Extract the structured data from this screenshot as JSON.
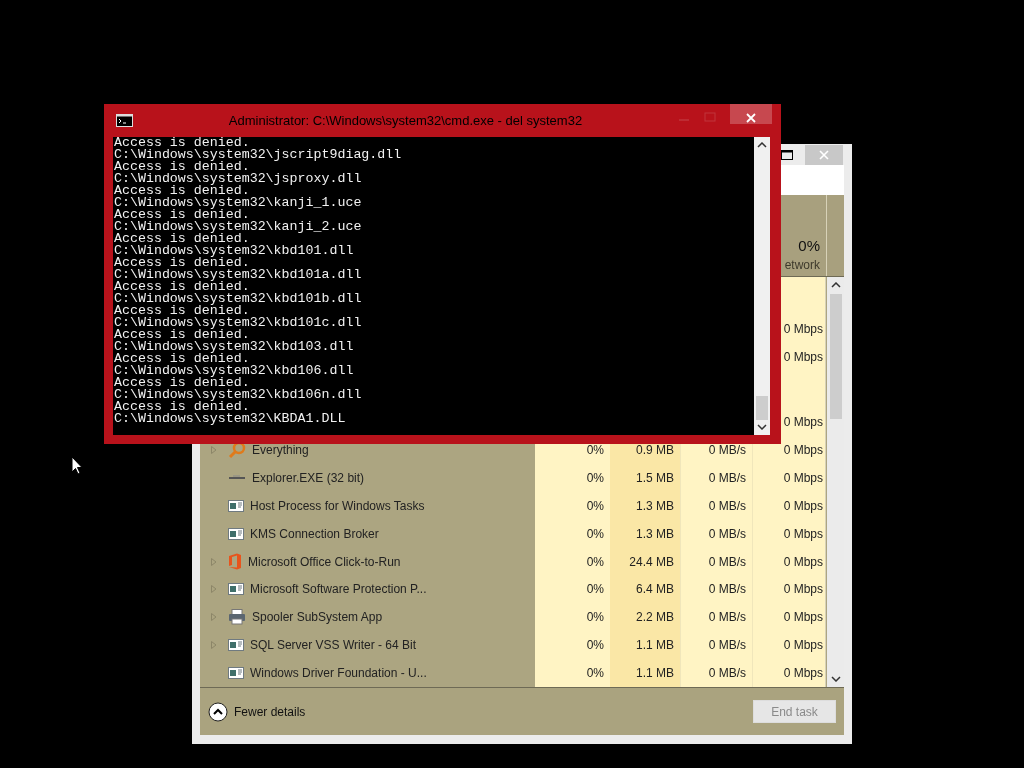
{
  "task_manager": {
    "header": {
      "network_percent": "0%",
      "network_label": "etwork"
    },
    "rows": [
      {
        "kind": "group"
      },
      {
        "kind": "process",
        "network": "0 Mbps"
      },
      {
        "kind": "process",
        "network": "0 Mbps"
      },
      {
        "kind": "group"
      },
      {
        "kind": "process",
        "network": "0 Mbps"
      },
      {
        "kind": "process",
        "expandable": true,
        "name": "Everything",
        "cpu": "0%",
        "memory": "0.9 MB",
        "disk": "0 MB/s",
        "network": "0 Mbps"
      },
      {
        "kind": "process",
        "expandable": false,
        "name": "Explorer.EXE (32 bit)",
        "cpu": "0%",
        "memory": "1.5 MB",
        "disk": "0 MB/s",
        "network": "0 Mbps"
      },
      {
        "kind": "process",
        "expandable": false,
        "name": "Host Process for Windows Tasks",
        "cpu": "0%",
        "memory": "1.3 MB",
        "disk": "0 MB/s",
        "network": "0 Mbps"
      },
      {
        "kind": "process",
        "expandable": false,
        "name": "KMS Connection Broker",
        "cpu": "0%",
        "memory": "1.3 MB",
        "disk": "0 MB/s",
        "network": "0 Mbps"
      },
      {
        "kind": "process",
        "expandable": true,
        "name": "Microsoft Office Click-to-Run",
        "cpu": "0%",
        "memory": "24.4 MB",
        "disk": "0 MB/s",
        "network": "0 Mbps"
      },
      {
        "kind": "process",
        "expandable": true,
        "name": "Microsoft Software Protection P...",
        "cpu": "0%",
        "memory": "6.4 MB",
        "disk": "0 MB/s",
        "network": "0 Mbps"
      },
      {
        "kind": "process",
        "expandable": true,
        "name": "Spooler SubSystem App",
        "cpu": "0%",
        "memory": "2.2 MB",
        "disk": "0 MB/s",
        "network": "0 Mbps"
      },
      {
        "kind": "process",
        "expandable": true,
        "name": "SQL Server VSS Writer - 64 Bit",
        "cpu": "0%",
        "memory": "1.1 MB",
        "disk": "0 MB/s",
        "network": "0 Mbps"
      },
      {
        "kind": "process",
        "expandable": false,
        "name": "Windows Driver Foundation - U...",
        "cpu": "0%",
        "memory": "1.1 MB",
        "disk": "0 MB/s",
        "network": "0 Mbps"
      }
    ],
    "footer": {
      "toggle": "Fewer details",
      "end_task": {
        "label": "End task",
        "disabled": true
      }
    }
  },
  "console": {
    "title": "Administrator: C:\\Windows\\system32\\cmd.exe - del  system32",
    "lines": [
      "Access is denied.",
      "C:\\Windows\\system32\\jscript9diag.dll",
      "Access is denied.",
      "C:\\Windows\\system32\\jsproxy.dll",
      "Access is denied.",
      "C:\\Windows\\system32\\kanji_1.uce",
      "Access is denied.",
      "C:\\Windows\\system32\\kanji_2.uce",
      "Access is denied.",
      "C:\\Windows\\system32\\kbd101.dll",
      "Access is denied.",
      "C:\\Windows\\system32\\kbd101a.dll",
      "Access is denied.",
      "C:\\Windows\\system32\\kbd101b.dll",
      "Access is denied.",
      "C:\\Windows\\system32\\kbd101c.dll",
      "Access is denied.",
      "C:\\Windows\\system32\\kbd103.dll",
      "Access is denied.",
      "C:\\Windows\\system32\\kbd106.dll",
      "Access is denied.",
      "C:\\Windows\\system32\\kbd106n.dll",
      "Access is denied.",
      "C:\\Windows\\system32\\KBDA1.DLL"
    ]
  }
}
